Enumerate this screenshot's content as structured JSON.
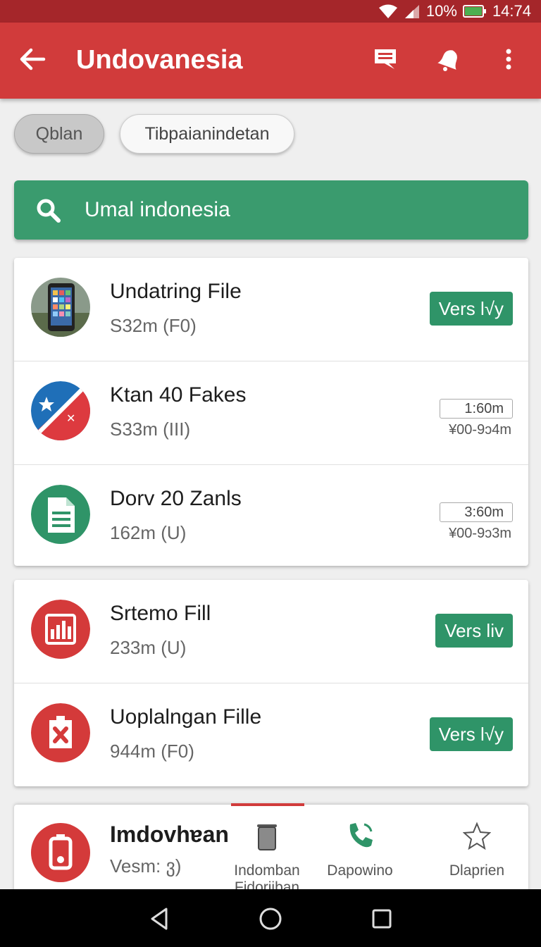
{
  "status": {
    "battery": "10%",
    "time": "14:74"
  },
  "appbar": {
    "title": "Undovanesia",
    "icons": [
      "back-arrow-icon",
      "chat-icon",
      "bell-icon",
      "more-vert-icon"
    ]
  },
  "chips": [
    {
      "label": "Qblan"
    },
    {
      "label": "Tibpaianindetan"
    }
  ],
  "search": {
    "value": "Umal indonesia"
  },
  "list": [
    {
      "name": "Undatring File",
      "sub": "S32m (F0)",
      "action": "Vers l√y"
    },
    {
      "name": "Ktan 40 Fakes",
      "sub": "S33m (III)",
      "tag": "1:60m",
      "tag2": "¥00-9ᴐ4m"
    },
    {
      "name": "Dorv 20 Zanls",
      "sub": "162m (U)",
      "tag": "3:60m",
      "tag2": "¥00-9ᴐ3m"
    },
    {
      "name": "Srtemo Fill",
      "sub": "233m (U)",
      "action": "Vers liv"
    },
    {
      "name": "Uoplalngan Fille",
      "sub": "944m (F0)",
      "action": "Vers l√y"
    }
  ],
  "bottom": {
    "name": "Imdovhɐan",
    "sub": "Vesm: ვ)",
    "nav": [
      {
        "label1": "Indomban",
        "label2": "Fidoriiban",
        "icon": "trash-icon"
      },
      {
        "label1": "Dapowino",
        "label2": "",
        "icon": "phone-icon"
      },
      {
        "label1": "Dlaprien",
        "label2": "",
        "icon": "star-icon"
      }
    ]
  },
  "colors": {
    "primary": "#d13b3b",
    "statusbar": "#a5262a",
    "green": "#3a9b6e",
    "red_avatar": "#d43a3a"
  }
}
